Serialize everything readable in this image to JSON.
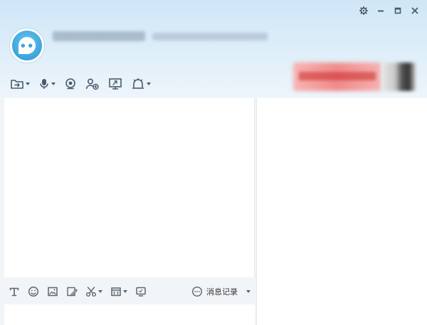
{
  "window": {
    "controls": [
      {
        "name": "settings",
        "icon": "gear-icon"
      },
      {
        "name": "minimize",
        "icon": "minimize-icon"
      },
      {
        "name": "maximize",
        "icon": "maximize-icon"
      },
      {
        "name": "close",
        "icon": "close-icon"
      }
    ]
  },
  "contact": {
    "avatar_icon": "qq-avatar-icon",
    "name": "",
    "signature": ""
  },
  "toolbar": {
    "items": [
      {
        "name": "file-transfer",
        "icon": "folder-icon",
        "has_dropdown": true
      },
      {
        "name": "voice-call",
        "icon": "microphone-icon",
        "has_dropdown": true
      },
      {
        "name": "video-call",
        "icon": "camera-icon",
        "has_dropdown": false
      },
      {
        "name": "add-friend",
        "icon": "person-add-icon",
        "has_dropdown": false
      },
      {
        "name": "remote-desktop",
        "icon": "screen-share-icon",
        "has_dropdown": false
      },
      {
        "name": "more-apps",
        "icon": "app-icon",
        "has_dropdown": true
      }
    ]
  },
  "input_toolbar": {
    "items": [
      {
        "name": "font",
        "icon": "text-format-icon",
        "has_dropdown": false
      },
      {
        "name": "emoji",
        "icon": "smiley-icon",
        "has_dropdown": false
      },
      {
        "name": "image",
        "icon": "picture-icon",
        "has_dropdown": false
      },
      {
        "name": "doodle",
        "icon": "pencil-icon",
        "has_dropdown": false
      },
      {
        "name": "screenshot",
        "icon": "scissors-icon",
        "has_dropdown": true
      },
      {
        "name": "calendar",
        "icon": "calendar-icon",
        "has_dropdown": true
      },
      {
        "name": "shake",
        "icon": "monitor-icon",
        "has_dropdown": false
      }
    ],
    "history_label": "消息记录"
  },
  "colors": {
    "accent": "#3aa4dc",
    "icon": "#4a5a6a",
    "header_top": "#cfe6f7",
    "ad": "#f08a8a"
  }
}
